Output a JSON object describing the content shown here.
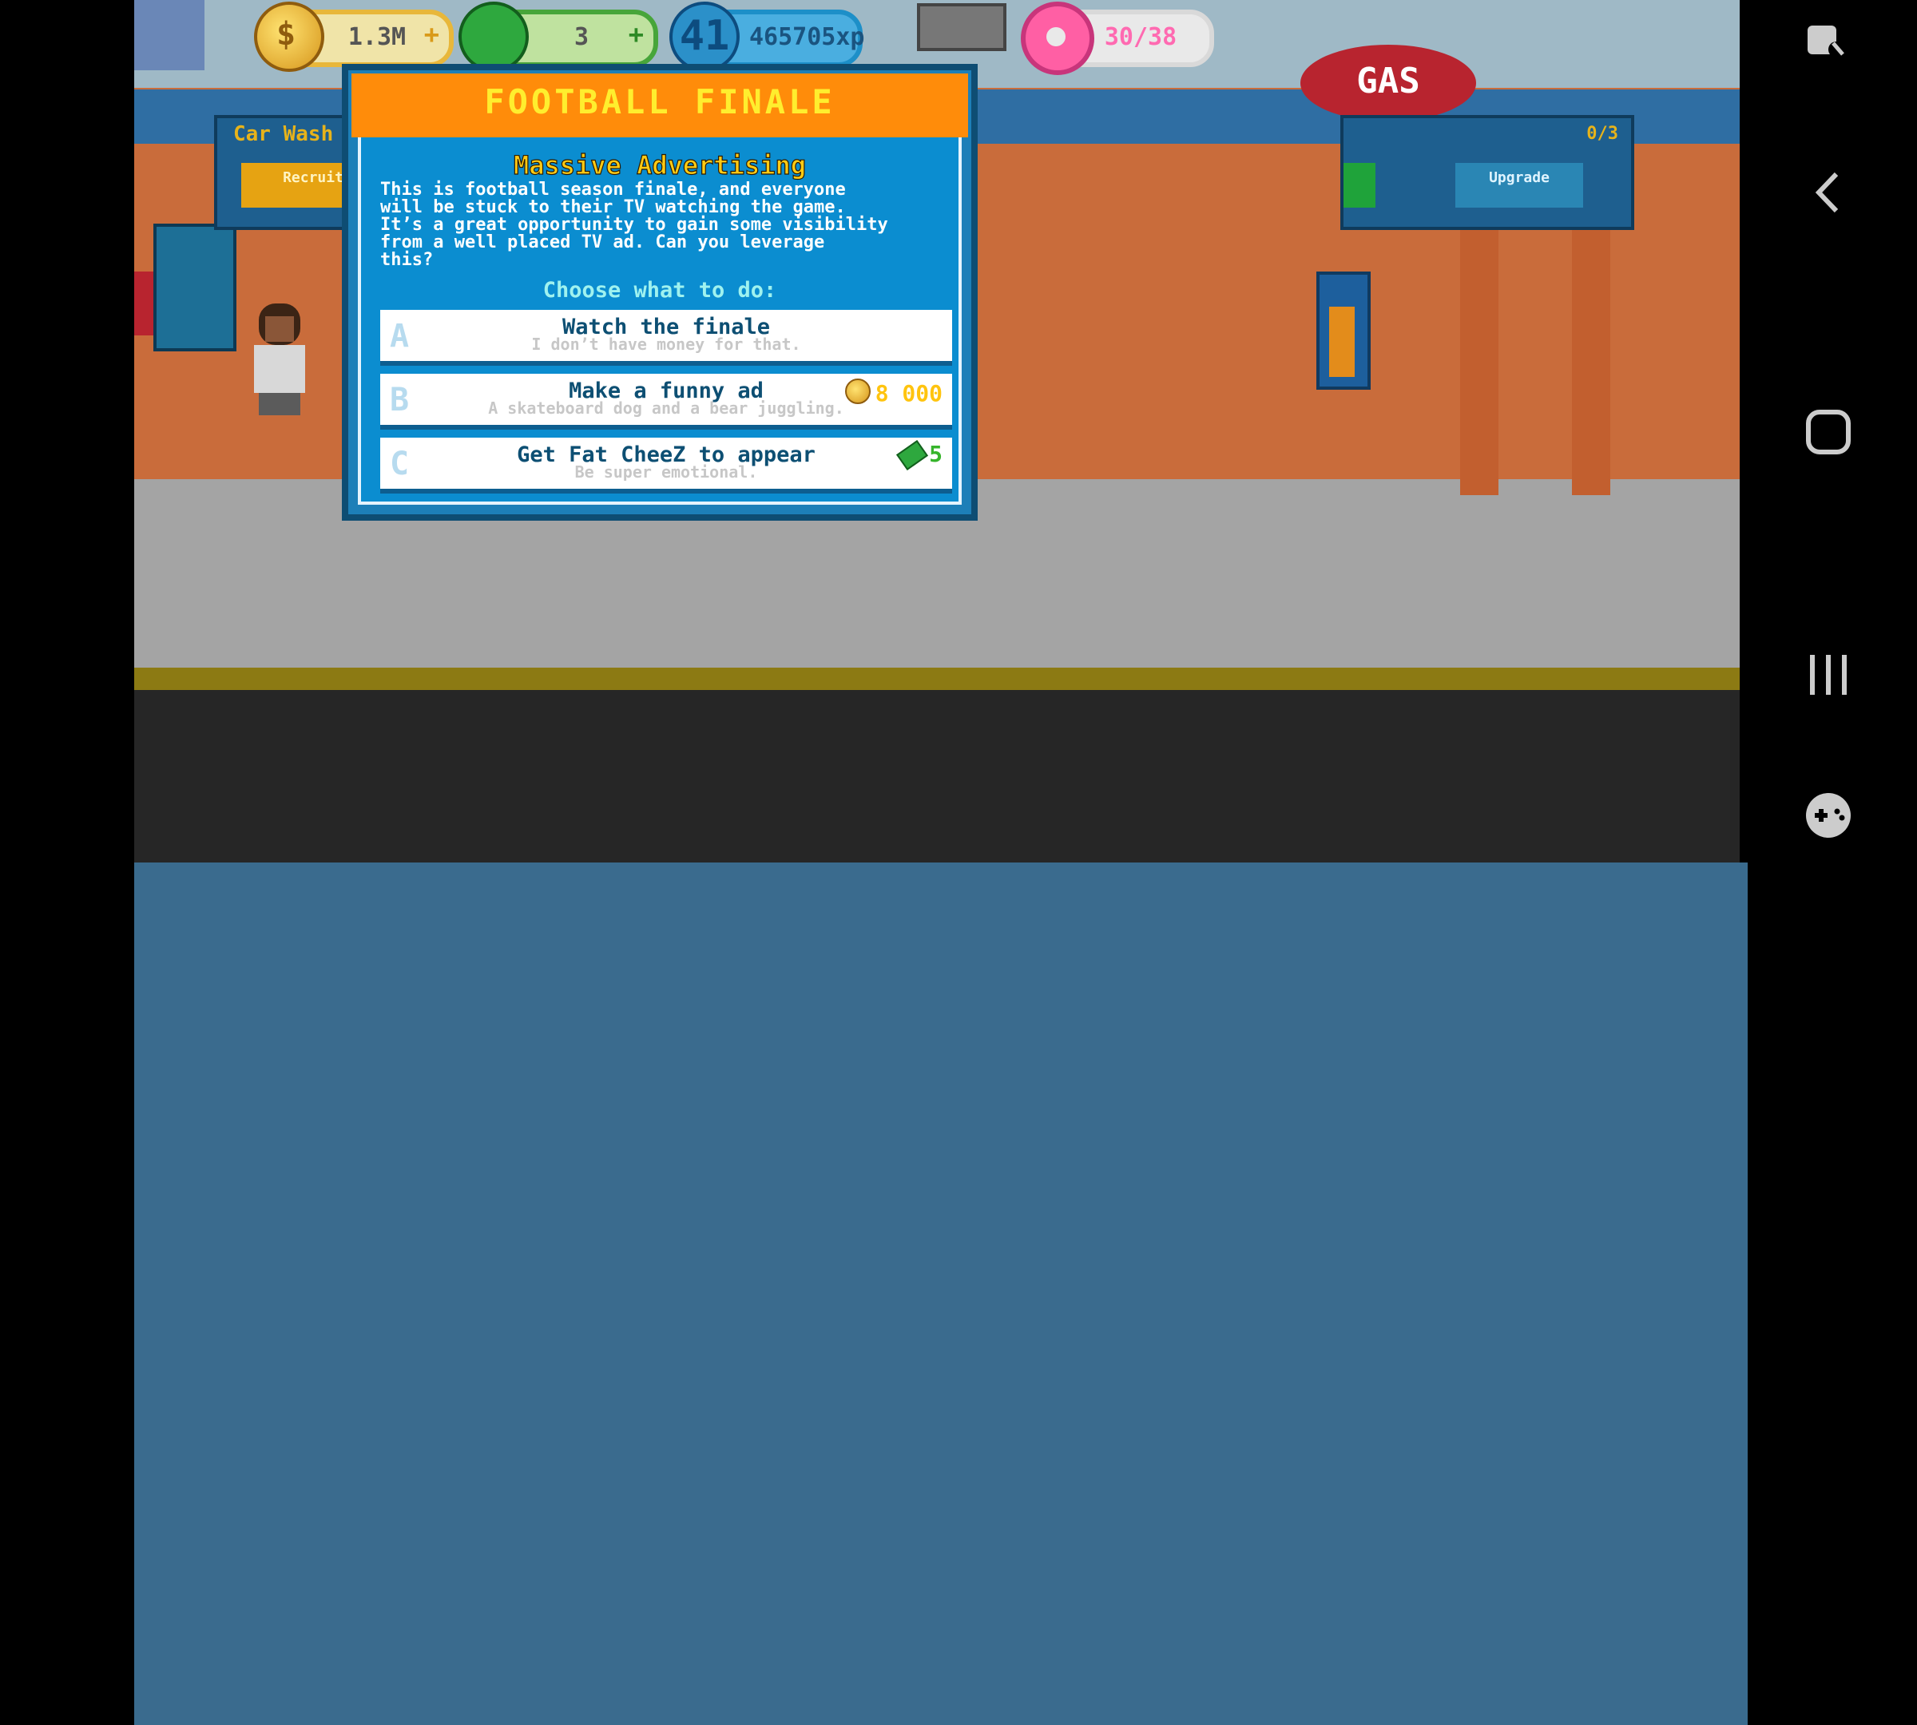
{
  "hud": {
    "coins": "1.3M",
    "cash": "3",
    "level": "41",
    "xp": "465705xp",
    "donuts": "30/38",
    "plus": "+"
  },
  "background": {
    "left_panel_title": "Car Wash",
    "left_panel_button": "Recruit",
    "right_panel_button": "Upgrade",
    "right_panel_count": "0/3",
    "gas_sign": "GAS"
  },
  "event": {
    "title": "FOOTBALL FINALE",
    "subtitle": "Massive Advertising",
    "description": "This is football season finale, and everyone\nwill be stuck to their TV watching the game.\nIt’s a great opportunity to gain some visibility\nfrom a well placed TV ad. Can you leverage\nthis?",
    "prompt": "Choose what to do:",
    "options": [
      {
        "letter": "A",
        "label": "Watch the finale",
        "note": "I don’t have money for that.",
        "cost": "",
        "cost_type": ""
      },
      {
        "letter": "B",
        "label": "Make a funny ad",
        "note": "A skateboard dog and a bear juggling.",
        "cost": "8 000",
        "cost_type": "coins"
      },
      {
        "letter": "C",
        "label": "Get Fat CheeZ to appear",
        "note": "Be super emotional.",
        "cost": "5",
        "cost_type": "cash"
      }
    ]
  },
  "nav": {
    "icons": [
      "screen-pin-icon",
      "back-icon",
      "home-icon",
      "recents-icon",
      "game-tools-icon"
    ]
  },
  "colors": {
    "title_bar": "#ff8c0a",
    "title_text": "#ffee2e",
    "modal_bg": "#0b8dd0",
    "subtitle": "#ffcb14"
  }
}
